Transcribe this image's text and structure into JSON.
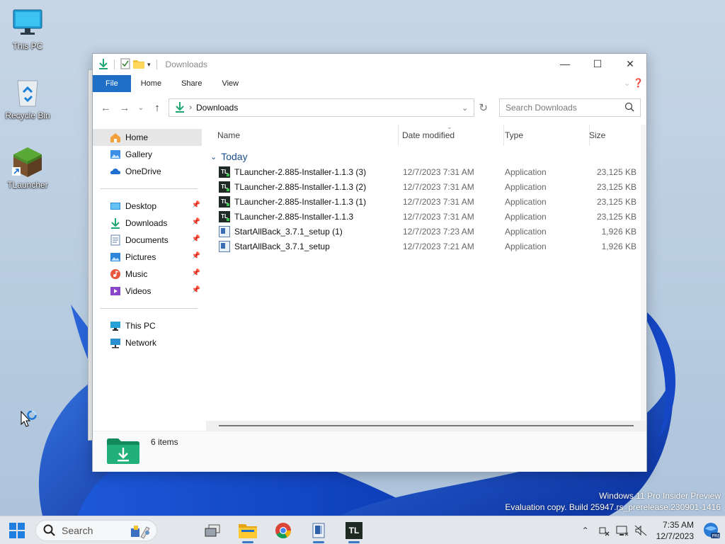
{
  "desktop": {
    "icons": [
      {
        "label": "This PC",
        "icon": "monitor-icon"
      },
      {
        "label": "Recycle Bin",
        "icon": "recycle-bin-icon"
      },
      {
        "label": "TLauncher",
        "icon": "minecraft-grass-block-icon"
      }
    ]
  },
  "window": {
    "title": "Downloads",
    "ribbon_tabs": [
      "File",
      "Home",
      "Share",
      "View"
    ],
    "address_path": "Downloads",
    "search_placeholder": "Search Downloads"
  },
  "nav": {
    "quick": [
      {
        "label": "Home",
        "icon": "home-icon"
      },
      {
        "label": "Gallery",
        "icon": "gallery-icon"
      },
      {
        "label": "OneDrive",
        "icon": "cloud-icon"
      }
    ],
    "pinned": [
      {
        "label": "Desktop",
        "icon": "desktop-folder-icon"
      },
      {
        "label": "Downloads",
        "icon": "download-arrow-icon"
      },
      {
        "label": "Documents",
        "icon": "documents-icon"
      },
      {
        "label": "Pictures",
        "icon": "pictures-icon"
      },
      {
        "label": "Music",
        "icon": "music-icon"
      },
      {
        "label": "Videos",
        "icon": "videos-icon"
      }
    ],
    "devices": [
      {
        "label": "This PC",
        "icon": "monitor-icon"
      },
      {
        "label": "Network",
        "icon": "network-icon"
      }
    ]
  },
  "columns": {
    "name": "Name",
    "date": "Date modified",
    "type": "Type",
    "size": "Size"
  },
  "group_label": "Today",
  "files": [
    {
      "name": "TLauncher-2.885-Installer-1.1.3 (3)",
      "date": "12/7/2023 7:31 AM",
      "type": "Application",
      "size": "23,125 KB",
      "icon": "tl"
    },
    {
      "name": "TLauncher-2.885-Installer-1.1.3 (2)",
      "date": "12/7/2023 7:31 AM",
      "type": "Application",
      "size": "23,125 KB",
      "icon": "tl"
    },
    {
      "name": "TLauncher-2.885-Installer-1.1.3 (1)",
      "date": "12/7/2023 7:31 AM",
      "type": "Application",
      "size": "23,125 KB",
      "icon": "tl"
    },
    {
      "name": "TLauncher-2.885-Installer-1.1.3",
      "date": "12/7/2023 7:31 AM",
      "type": "Application",
      "size": "23,125 KB",
      "icon": "tl"
    },
    {
      "name": "StartAllBack_3.7.1_setup (1)",
      "date": "12/7/2023 7:23 AM",
      "type": "Application",
      "size": "1,926 KB",
      "icon": "sab"
    },
    {
      "name": "StartAllBack_3.7.1_setup",
      "date": "12/7/2023 7:21 AM",
      "type": "Application",
      "size": "1,926 KB",
      "icon": "sab"
    }
  ],
  "status": {
    "count": "6 items"
  },
  "watermark": {
    "line1": "Windows 11 Pro Insider Preview",
    "line2": "Evaluation copy. Build 25947.rs_prerelease.230901-1416"
  },
  "taskbar": {
    "search_label": "Search",
    "time": "7:35 AM",
    "date": "12/7/2023",
    "tl_label": "TL"
  },
  "colors": {
    "accent": "#1e6fc5",
    "folder_green": "#1fa672"
  }
}
